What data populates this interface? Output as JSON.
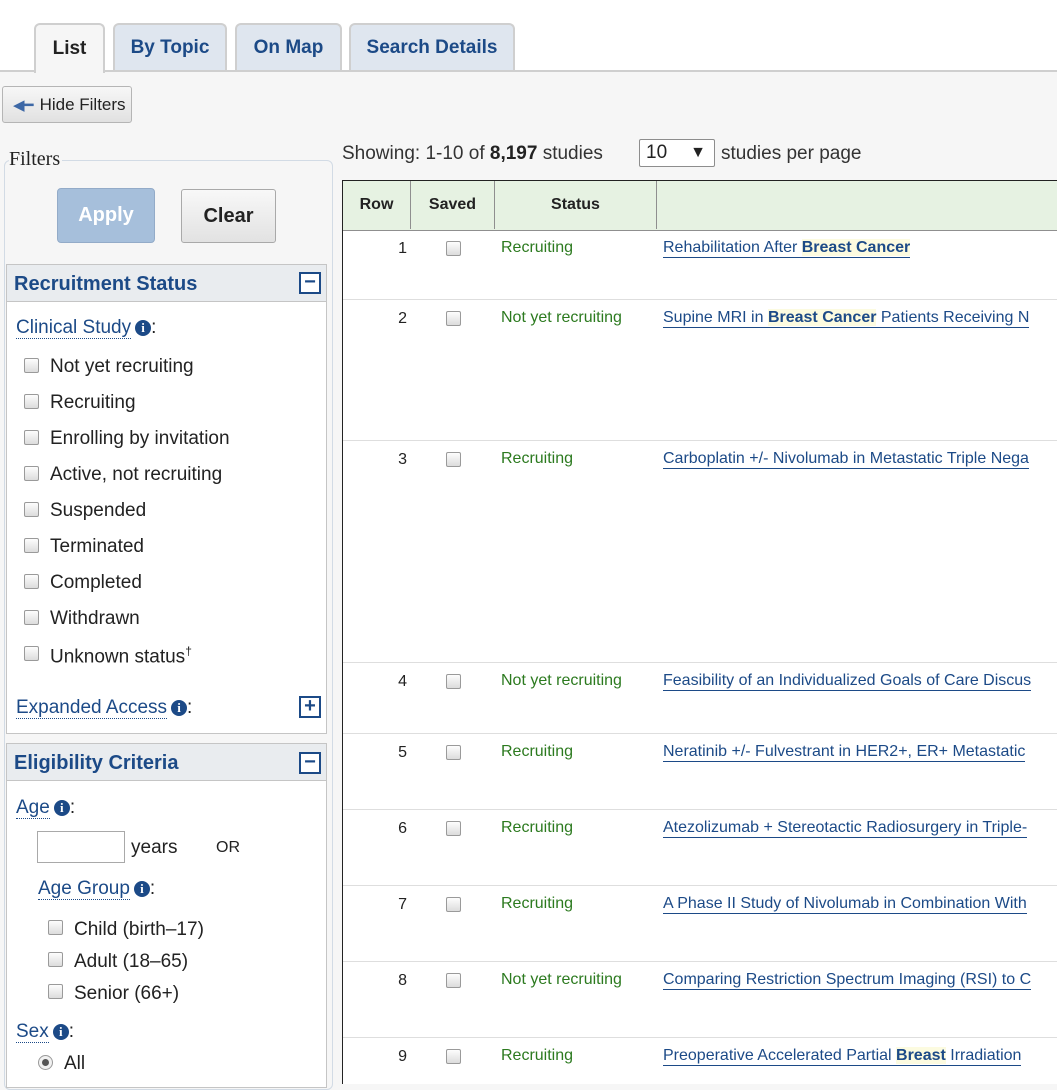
{
  "tabs": [
    {
      "label": "List",
      "active": true
    },
    {
      "label": "By Topic",
      "active": false
    },
    {
      "label": "On Map",
      "active": false
    },
    {
      "label": "Search Details",
      "active": false
    }
  ],
  "hide_filters_label": "Hide Filters",
  "filters": {
    "legend": "Filters",
    "apply_label": "Apply",
    "clear_label": "Clear",
    "recruitment": {
      "title": "Recruitment Status",
      "clinical_study_label": "Clinical Study",
      "options": [
        "Not yet recruiting",
        "Recruiting",
        "Enrolling by invitation",
        "Active, not recruiting",
        "Suspended",
        "Terminated",
        "Completed",
        "Withdrawn",
        "Unknown status"
      ],
      "unknown_mark": "†",
      "expanded_access_label": "Expanded Access"
    },
    "eligibility": {
      "title": "Eligibility Criteria",
      "age_label": "Age",
      "years_label": "years",
      "or_label": "OR",
      "age_group_label": "Age Group",
      "age_groups": [
        "Child (birth–17)",
        "Adult (18–65)",
        "Senior (66+)"
      ],
      "sex_label": "Sex",
      "sex_selected": "All"
    }
  },
  "results": {
    "showing_prefix": "Showing: 1-10 of",
    "total": "8,197",
    "showing_suffix": "studies",
    "per_page_value": "10",
    "per_page_label": "studies per page",
    "columns": [
      "Row",
      "Saved",
      "Status"
    ],
    "rows": [
      {
        "row": "1",
        "status": "Recruiting",
        "title_pre": "Rehabilitation After ",
        "title_hl": "Breast Cancer",
        "title_post": ""
      },
      {
        "row": "2",
        "status": "Not yet recruiting",
        "title_pre": "Supine MRI in ",
        "title_hl": "Breast Cancer",
        "title_post": " Patients Receiving N"
      },
      {
        "row": "3",
        "status": "Recruiting",
        "title_pre": "Carboplatin +/- Nivolumab in Metastatic Triple Nega",
        "title_hl": "",
        "title_post": ""
      },
      {
        "row": "4",
        "status": "Not yet recruiting",
        "title_pre": "Feasibility of an Individualized Goals of Care Discus",
        "title_hl": "",
        "title_post": ""
      },
      {
        "row": "5",
        "status": "Recruiting",
        "title_pre": "Neratinib +/- Fulvestrant in HER2+, ER+ Metastatic",
        "title_hl": "",
        "title_post": ""
      },
      {
        "row": "6",
        "status": "Recruiting",
        "title_pre": "Atezolizumab + Stereotactic Radiosurgery in Triple-",
        "title_hl": "",
        "title_post": ""
      },
      {
        "row": "7",
        "status": "Recruiting",
        "title_pre": "A Phase II Study of Nivolumab in Combination With",
        "title_hl": "",
        "title_post": ""
      },
      {
        "row": "8",
        "status": "Not yet recruiting",
        "title_pre": "Comparing Restriction Spectrum Imaging (RSI) to C",
        "title_hl": "",
        "title_post": ""
      },
      {
        "row": "9",
        "status": "Recruiting",
        "title_pre": "Preoperative Accelerated Partial ",
        "title_hl": "Breast",
        "title_post": " Irradiation"
      }
    ]
  }
}
